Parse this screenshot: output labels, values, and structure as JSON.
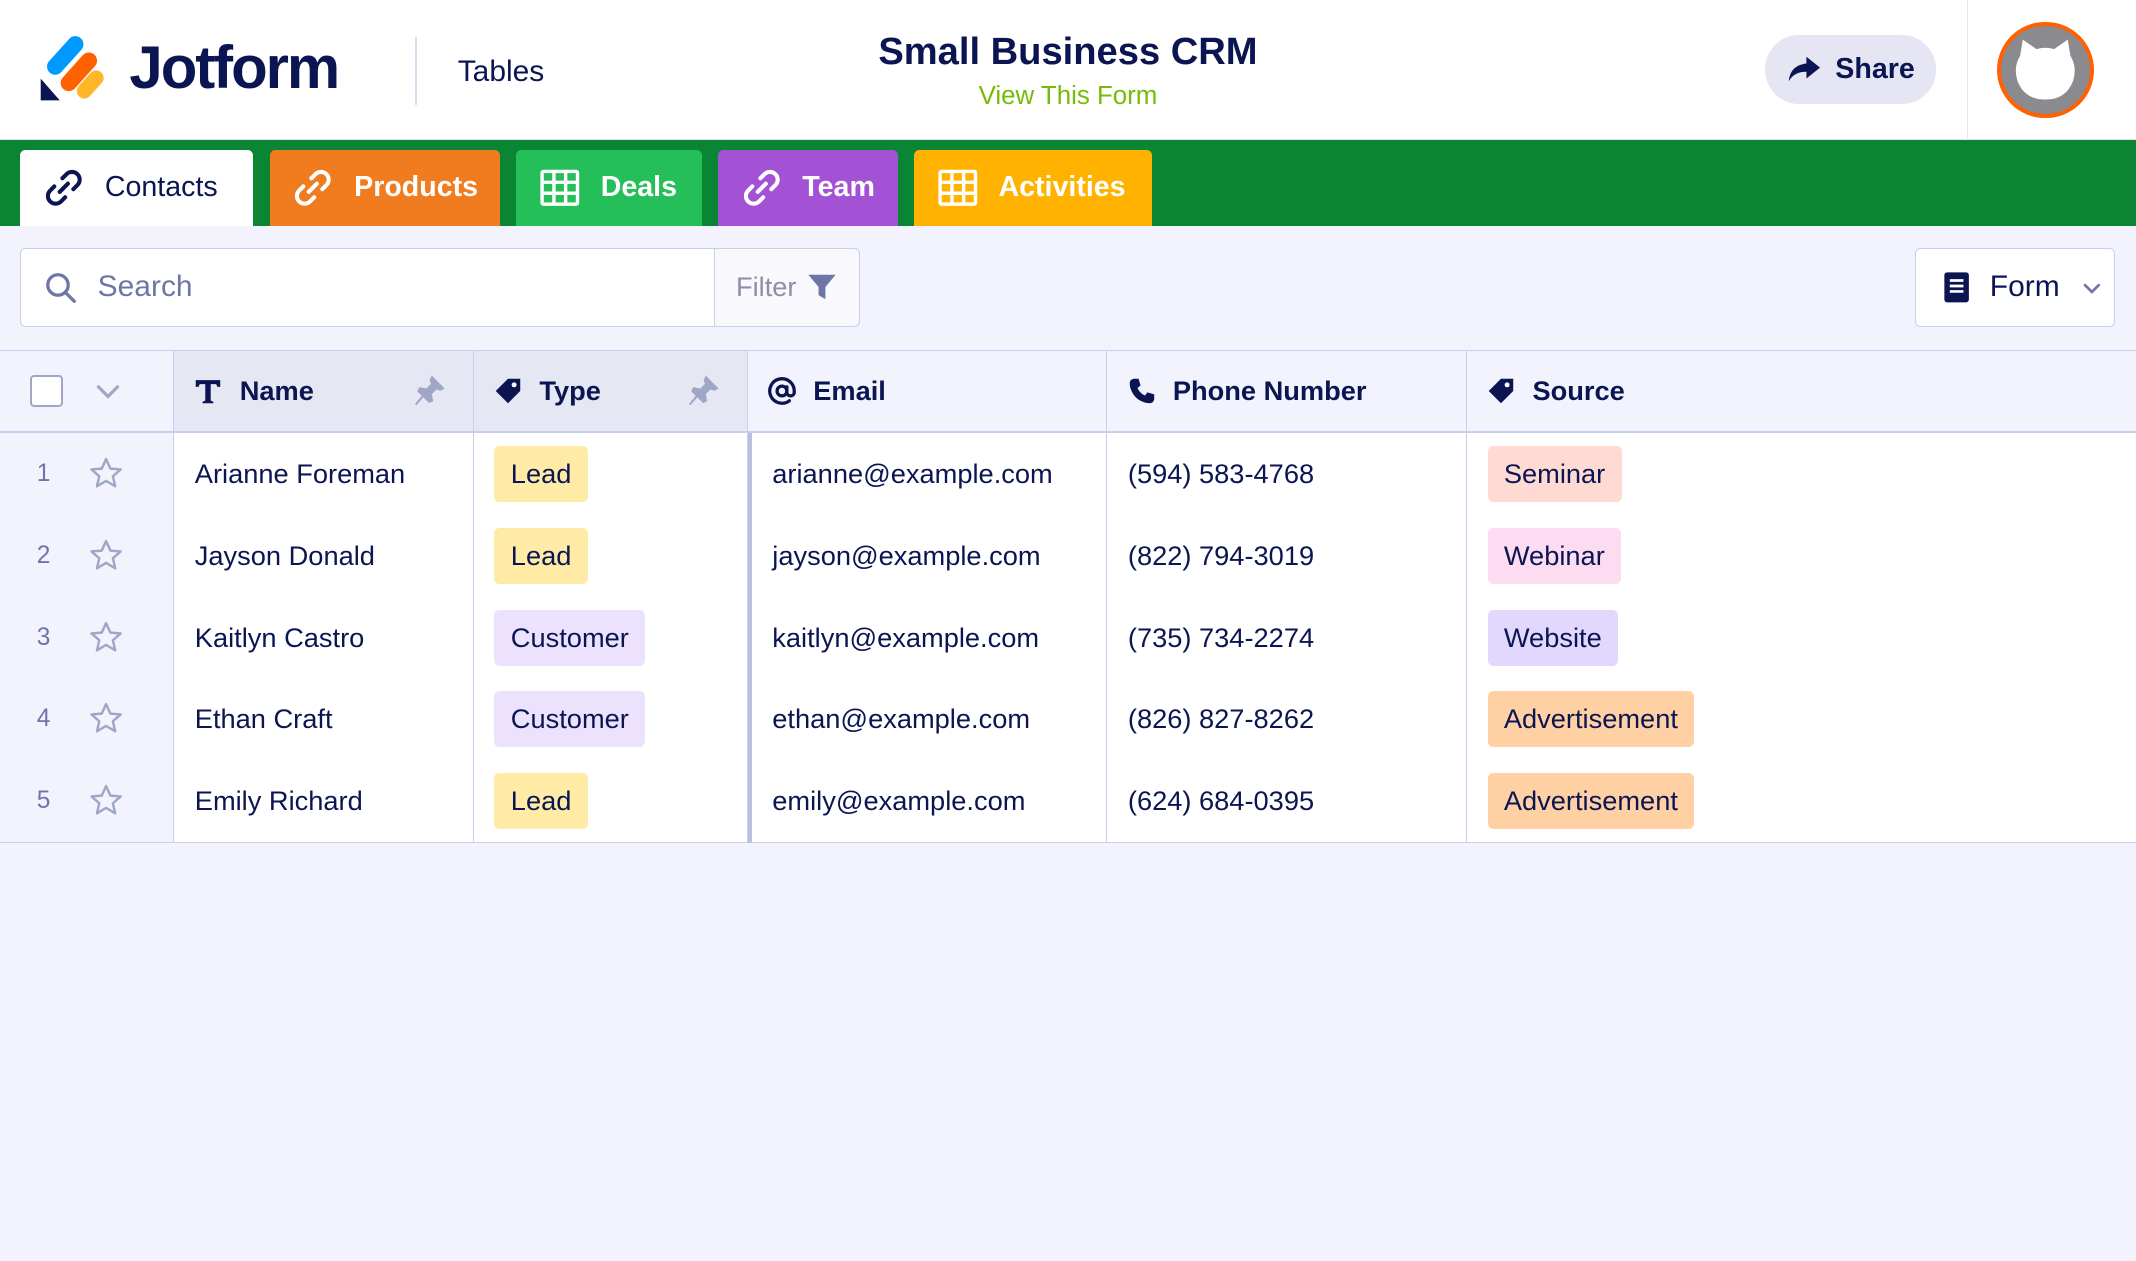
{
  "header": {
    "brand": "Jotform",
    "product": "Tables",
    "title": "Small Business CRM",
    "subtitle_link": "View This Form",
    "share_label": "Share"
  },
  "tabs": [
    {
      "label": "Contacts",
      "icon": "link-icon",
      "color": "#ffffff",
      "active": true
    },
    {
      "label": "Products",
      "icon": "link-icon",
      "color": "#f07c1f",
      "active": false
    },
    {
      "label": "Deals",
      "icon": "table-grid-icon",
      "color": "#25bf59",
      "active": false
    },
    {
      "label": "Team",
      "icon": "link-icon",
      "color": "#a352d6",
      "active": false
    },
    {
      "label": "Activities",
      "icon": "table-grid-icon",
      "color": "#ffb300",
      "active": false
    }
  ],
  "toolbar": {
    "search_placeholder": "Search",
    "filter_label": "Filter",
    "form_label": "Form"
  },
  "columns": [
    {
      "label": "Name",
      "icon": "text-type-icon",
      "pinned": true
    },
    {
      "label": "Type",
      "icon": "tag-icon",
      "pinned": true
    },
    {
      "label": "Email",
      "icon": "at-sign-icon",
      "pinned": false
    },
    {
      "label": "Phone Number",
      "icon": "phone-icon",
      "pinned": false
    },
    {
      "label": "Source",
      "icon": "tag-icon",
      "pinned": false
    }
  ],
  "rows": [
    {
      "num": "1",
      "name": "Arianne Foreman",
      "type": "Lead",
      "email": "arianne@example.com",
      "phone": "(594) 583-4768",
      "source": "Seminar"
    },
    {
      "num": "2",
      "name": "Jayson Donald",
      "type": "Lead",
      "email": "jayson@example.com",
      "phone": "(822) 794-3019",
      "source": "Webinar"
    },
    {
      "num": "3",
      "name": "Kaitlyn Castro",
      "type": "Customer",
      "email": "kaitlyn@example.com",
      "phone": "(735) 734-2274",
      "source": "Website"
    },
    {
      "num": "4",
      "name": "Ethan Craft",
      "type": "Customer",
      "email": "ethan@example.com",
      "phone": "(826) 827-8262",
      "source": "Advertisement"
    },
    {
      "num": "5",
      "name": "Emily Richard",
      "type": "Lead",
      "email": "emily@example.com",
      "phone": "(624) 684-0395",
      "source": "Advertisement"
    }
  ],
  "tag_colors": {
    "Lead": "#ffeaa6",
    "Customer": "#ece2fe",
    "Seminar": "#ffdad3",
    "Webinar": "#fddcf1",
    "Website": "#e2d8fd",
    "Advertisement": "#ffd0a3"
  },
  "colors": {
    "tabbar": "#0a8534",
    "accent_green": "#78bb07",
    "navy": "#0a1551"
  }
}
